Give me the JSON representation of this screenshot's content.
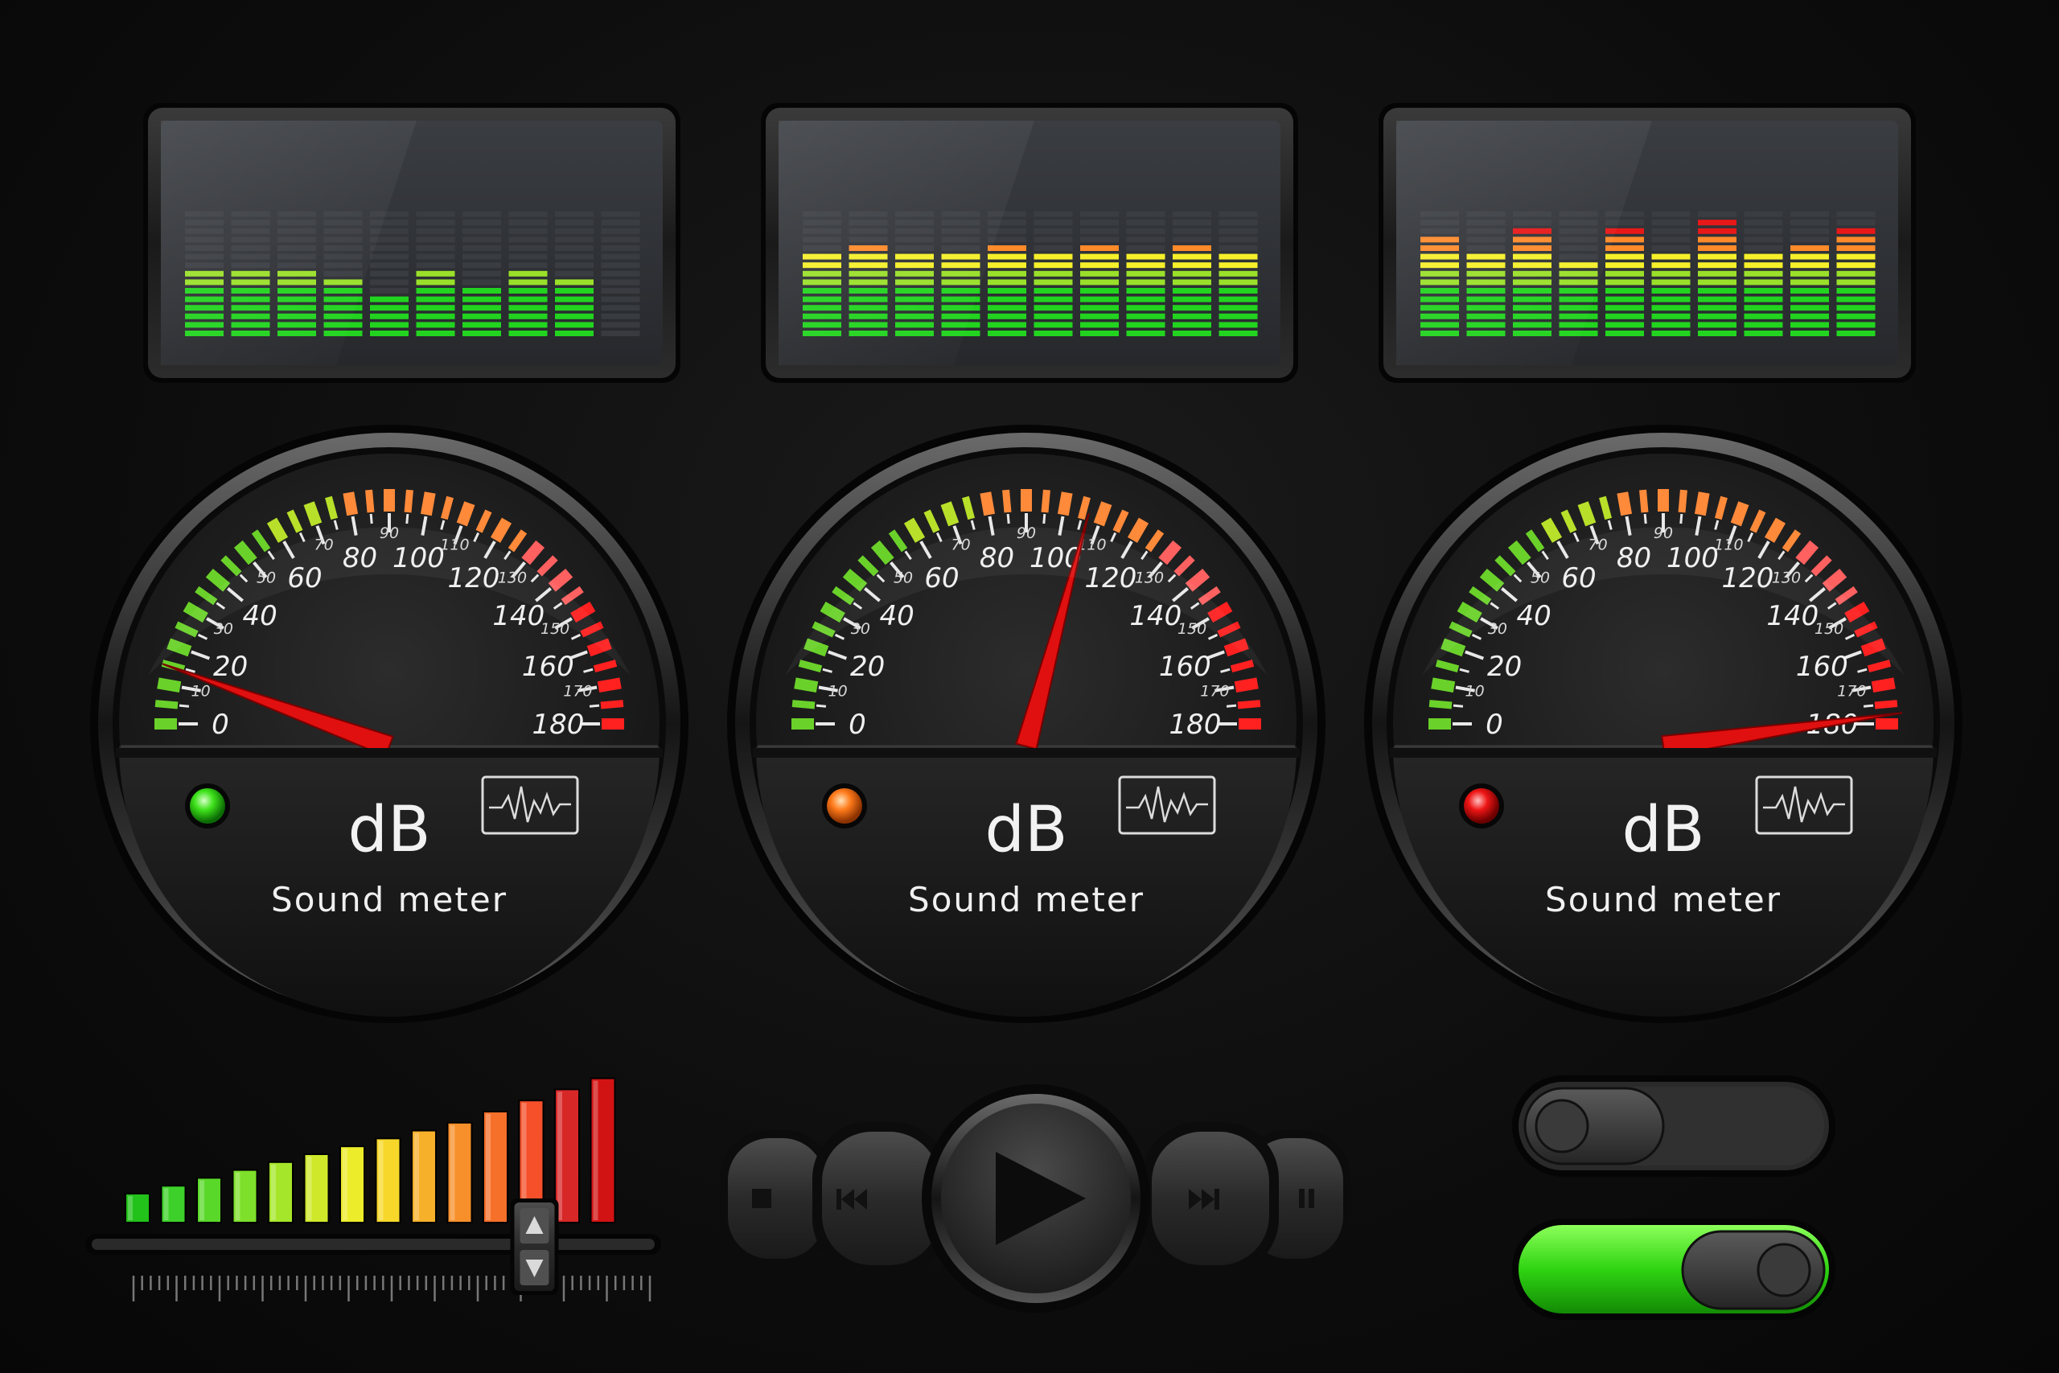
{
  "colors": {
    "green": "#22d41f",
    "yellow": "#f5f02a",
    "orange": "#ff8a2a",
    "red": "#e81818",
    "needle": "#e01010",
    "toggle_on": "#3ee21a",
    "background": "#0f0f0f"
  },
  "equalizers": [
    {
      "name": "equalizer-low",
      "bands": [
        8,
        8,
        8,
        7,
        5,
        8,
        6,
        8,
        7,
        0
      ],
      "total_segments": 15
    },
    {
      "name": "equalizer-mid",
      "bands": [
        10,
        11,
        10,
        10,
        11,
        10,
        11,
        10,
        11,
        10
      ],
      "total_segments": 15
    },
    {
      "name": "equalizer-high",
      "bands": [
        12,
        10,
        13,
        9,
        13,
        10,
        14,
        10,
        11,
        13
      ],
      "total_segments": 15
    }
  ],
  "gauges": [
    {
      "name": "gauge-low",
      "value": 20,
      "indicator": "green",
      "unit_label": "dB",
      "caption": "Sound meter"
    },
    {
      "name": "gauge-mid",
      "value": 105,
      "indicator": "orange",
      "unit_label": "dB",
      "caption": "Sound meter"
    },
    {
      "name": "gauge-high",
      "value": 172,
      "indicator": "red",
      "unit_label": "dB",
      "caption": "Sound meter"
    }
  ],
  "gauge_scale": {
    "min": 0,
    "max": 180,
    "major_labels": [
      "0",
      "20",
      "40",
      "60",
      "80",
      "100",
      "120",
      "140",
      "160",
      "180"
    ],
    "minor_labels": [
      "10",
      "30",
      "50",
      "70",
      "90",
      "110",
      "130",
      "150",
      "170"
    ]
  },
  "level_meter": {
    "bars": 14,
    "active_bars": 12,
    "slider_value": 0.78
  },
  "transport": {
    "stop_icon": "stop-icon",
    "prev_icon": "skip-back-icon",
    "play_icon": "play-icon",
    "next_icon": "skip-forward-icon",
    "pause_icon": "pause-icon"
  },
  "toggles": [
    {
      "name": "toggle-off",
      "state": "off"
    },
    {
      "name": "toggle-on",
      "state": "on"
    }
  ]
}
